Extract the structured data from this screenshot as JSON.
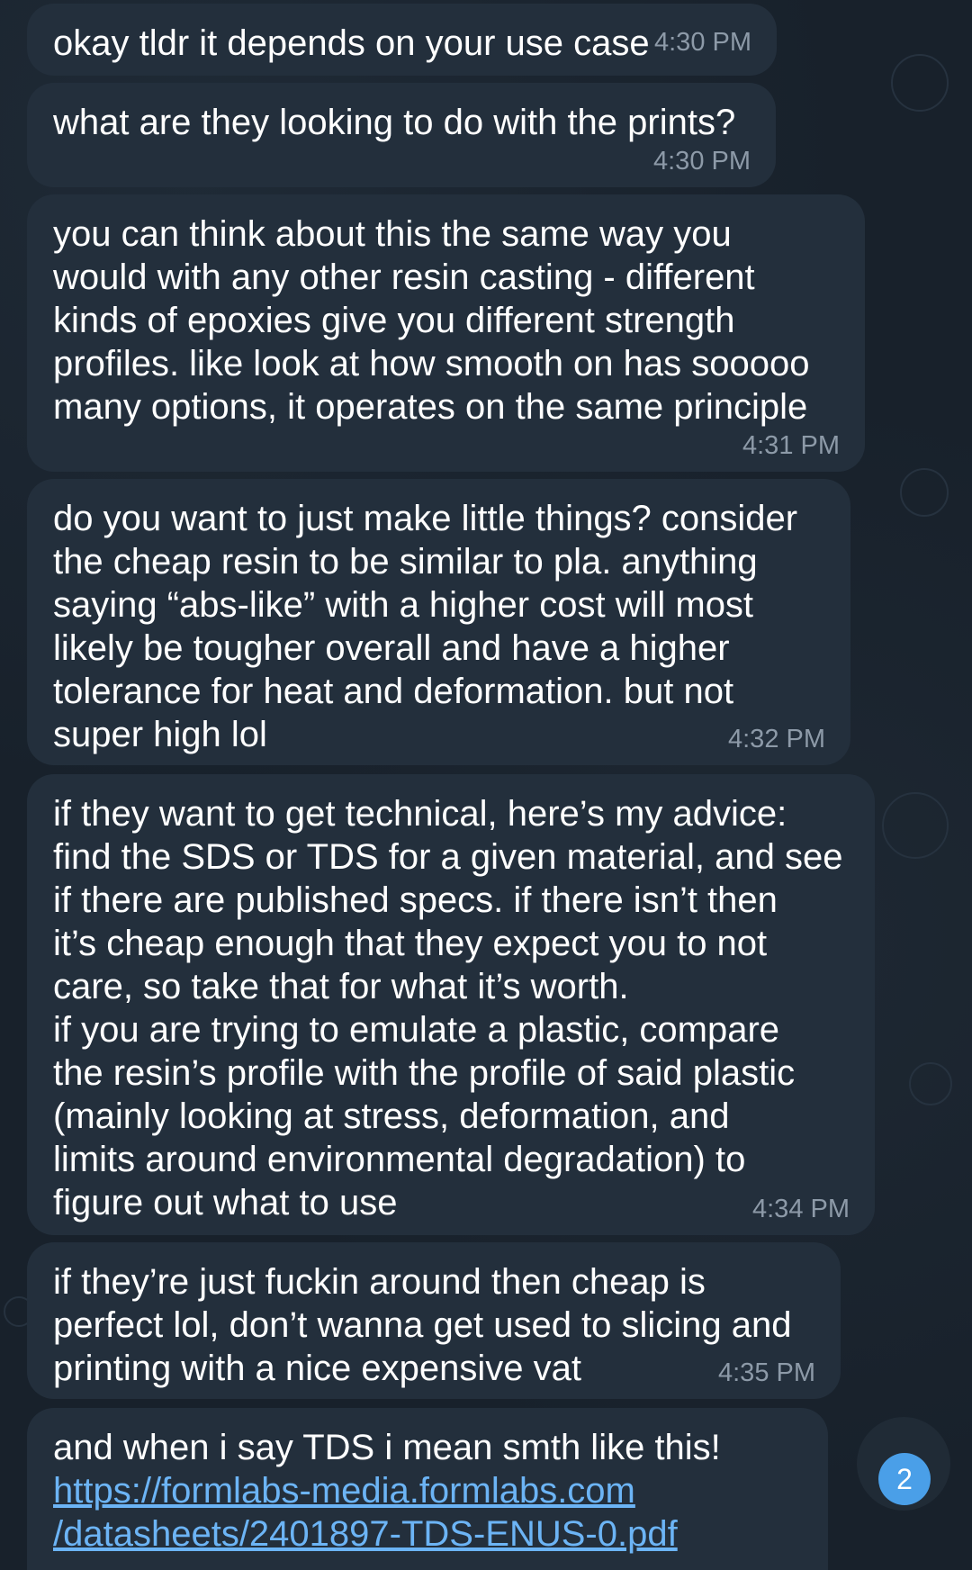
{
  "messages": [
    {
      "text": "okay tldr it depends on your use case",
      "time": "4:30 PM"
    },
    {
      "text": "what are they looking to do with the prints?",
      "time": "4:30 PM"
    },
    {
      "text": "you can think about this the same way you\nwould with any other resin casting - different\nkinds of epoxies give you different strength\nprofiles. like look at how smooth on has sooooo\nmany options, it operates on the same principle",
      "time": "4:31 PM"
    },
    {
      "text": "do you want to just make little things? consider\nthe cheap resin to be similar to pla. anything\nsaying “abs-like” with a higher cost will most\nlikely be tougher overall and have a higher\ntolerance for heat and deformation. but not\nsuper high lol",
      "time": "4:32 PM"
    },
    {
      "text": "if they want to get technical, here’s my advice:\nfind the SDS or TDS for a given material, and see\nif there are published specs. if there isn’t then\nit’s cheap enough that they expect you to not\ncare, so take that for what it’s worth.\nif you are trying to emulate a plastic, compare\nthe resin’s profile with the profile of said plastic\n(mainly looking at stress, deformation, and\nlimits around environmental degradation) to\nfigure out what to use",
      "time": "4:34 PM"
    },
    {
      "text": "if they’re just fuckin around then cheap is\nperfect lol, don’t wanna get used to slicing and\nprinting with a nice expensive vat",
      "time": "4:35 PM"
    },
    {
      "text": "and when i say TDS i mean smth like this!",
      "link_line1": "https://formlabs-media.formlabs.com",
      "link_line2": "/datasheets/2401897-TDS-ENUS-0.pdf"
    }
  ],
  "scroll_button": {
    "icon": "chevron-down-icon",
    "unread_count": "2"
  },
  "colors": {
    "bubble": "#232f3c",
    "link": "#6cb4f5",
    "badge": "#4a9fe8",
    "time": "#8d9aa8"
  }
}
